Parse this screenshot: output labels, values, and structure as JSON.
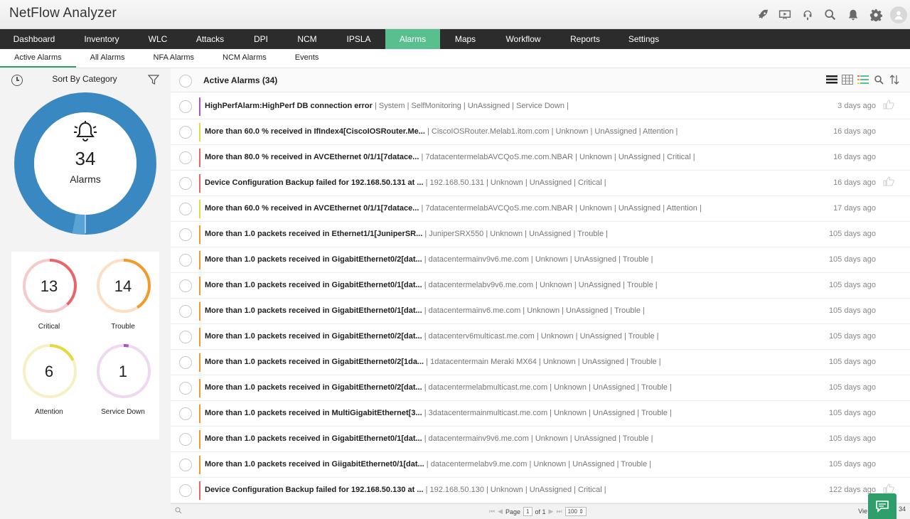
{
  "app": {
    "title": "NetFlow Analyzer"
  },
  "top_icons": [
    "rocket-icon",
    "presentation-icon",
    "headset-icon",
    "search-icon",
    "bell-icon",
    "gear-icon",
    "user-icon"
  ],
  "nav": {
    "items": [
      {
        "label": "Dashboard",
        "active": false
      },
      {
        "label": "Inventory",
        "active": false
      },
      {
        "label": "WLC",
        "active": false
      },
      {
        "label": "Attacks",
        "active": false
      },
      {
        "label": "DPI",
        "active": false
      },
      {
        "label": "NCM",
        "active": false
      },
      {
        "label": "IPSLA",
        "active": false
      },
      {
        "label": "Alarms",
        "active": true
      },
      {
        "label": "Maps",
        "active": false
      },
      {
        "label": "Workflow",
        "active": false
      },
      {
        "label": "Reports",
        "active": false
      },
      {
        "label": "Settings",
        "active": false
      }
    ]
  },
  "subnav": {
    "items": [
      {
        "label": "Active Alarms",
        "active": true
      },
      {
        "label": "All Alarms",
        "active": false
      },
      {
        "label": "NFA Alarms",
        "active": false
      },
      {
        "label": "NCM Alarms",
        "active": false
      },
      {
        "label": "Events",
        "active": false
      }
    ]
  },
  "sidebar": {
    "sort_label": "Sort By Category",
    "donut": {
      "count": "34",
      "label": "Alarms",
      "segments": [
        {
          "name": "Critical",
          "value": 13,
          "color": "#3a88c2"
        },
        {
          "name": "Trouble",
          "value": 14,
          "color": "#3a88c2"
        },
        {
          "name": "Attention",
          "value": 6,
          "color": "#3a88c2"
        },
        {
          "name": "Service Down",
          "value": 1,
          "color": "#5aa3d6"
        }
      ]
    },
    "severities": [
      {
        "name": "Critical",
        "count": "13",
        "color": "#e8666a",
        "track": "#f6c9ca",
        "fraction": 0.38
      },
      {
        "name": "Trouble",
        "count": "14",
        "color": "#f39a2b",
        "track": "#fde0c3",
        "fraction": 0.41
      },
      {
        "name": "Attention",
        "count": "6",
        "color": "#e6d840",
        "track": "#f6f1c4",
        "fraction": 0.18
      },
      {
        "name": "Service Down",
        "count": "1",
        "color": "#a855c7",
        "track": "#efd8f2",
        "fraction": 0.03
      }
    ]
  },
  "list": {
    "title": "Active Alarms (34)",
    "rows": [
      {
        "msg": "HighPerfAlarm:HighPerf DB connection error",
        "details": " | System | SelfMonitoring | UnAssigned | Service Down |",
        "age": "3 days ago",
        "color": "#a855c7",
        "thumb": true
      },
      {
        "msg": "More than 60.0 % received in IfIndex4[CiscoIOSRouter.Me...",
        "details": " | CiscoIOSRouter.Melab1.itom.com | Unknown | UnAssigned | Attention |",
        "age": "16 days ago",
        "color": "#e6d840",
        "thumb": false
      },
      {
        "msg": "More than 80.0 % received in AVCEthernet 0/1/1[7datace...",
        "details": " | 7datacentermelabAVCQoS.me.com.NBAR | Unknown | UnAssigned | Critical |",
        "age": "16 days ago",
        "color": "#e8666a",
        "thumb": false
      },
      {
        "msg": "Device Configuration Backup failed for 192.168.50.131 at ...",
        "details": " | 192.168.50.131 | Unknown | UnAssigned | Critical |",
        "age": "16 days ago",
        "color": "#e8666a",
        "thumb": true
      },
      {
        "msg": "More than 60.0 % received in AVCEthernet 0/1/1[7datace...",
        "details": " | 7datacentermelabAVCQoS.me.com.NBAR | Unknown | UnAssigned | Attention |",
        "age": "17 days ago",
        "color": "#e6d840",
        "thumb": false
      },
      {
        "msg": "More than 1.0 packets received in Ethernet1/1[JuniperSR...",
        "details": " | JuniperSRX550 | Unknown | UnAssigned | Trouble |",
        "age": "105 days ago",
        "color": "#f39a2b",
        "thumb": false
      },
      {
        "msg": "More than 1.0 packets received in GigabitEthernet0/2[dat...",
        "details": " | datacentermainv9v6.me.com | Unknown | UnAssigned | Trouble |",
        "age": "105 days ago",
        "color": "#f39a2b",
        "thumb": false
      },
      {
        "msg": "More than 1.0 packets received in GigabitEthernet0/1[dat...",
        "details": " | datacentermelabv9v6.me.com | Unknown | UnAssigned | Trouble |",
        "age": "105 days ago",
        "color": "#f39a2b",
        "thumb": false
      },
      {
        "msg": "More than 1.0 packets received in GigabitEthernet0/1[dat...",
        "details": " | datacentermainv6.me.com | Unknown | UnAssigned | Trouble |",
        "age": "105 days ago",
        "color": "#f39a2b",
        "thumb": false
      },
      {
        "msg": "More than 1.0 packets received in GigabitEthernet0/2[dat...",
        "details": " | datacenterv6multicast.me.com | Unknown | UnAssigned | Trouble |",
        "age": "105 days ago",
        "color": "#f39a2b",
        "thumb": false
      },
      {
        "msg": "More than 1.0 packets received in GigabitEthernet0/2[1da...",
        "details": " | 1datacentermain Meraki MX64 | Unknown | UnAssigned | Trouble |",
        "age": "105 days ago",
        "color": "#f39a2b",
        "thumb": false
      },
      {
        "msg": "More than 1.0 packets received in GigabitEthernet0/2[dat...",
        "details": " | datacentermelabmulticast.me.com | Unknown | UnAssigned | Trouble |",
        "age": "105 days ago",
        "color": "#f39a2b",
        "thumb": false
      },
      {
        "msg": "More than 1.0 packets received in MultiGigabitEthernet[3...",
        "details": " | 3datacentermainmulticast.me.com | Unknown | UnAssigned | Trouble |",
        "age": "105 days ago",
        "color": "#f39a2b",
        "thumb": false
      },
      {
        "msg": "More than 1.0 packets received in GigabitEthernet0/1[dat...",
        "details": " | datacentermainv9v6.me.com | Unknown | UnAssigned | Trouble |",
        "age": "105 days ago",
        "color": "#f39a2b",
        "thumb": false
      },
      {
        "msg": "More than 1.0 packets received in GiigabitEthernet0/1[dat...",
        "details": " | datacentermelabv9.me.com | Unknown | UnAssigned | Trouble |",
        "age": "105 days ago",
        "color": "#f39a2b",
        "thumb": false
      },
      {
        "msg": "Device Configuration Backup failed for 192.168.50.130 at ...",
        "details": " | 192.168.50.130 | Unknown | UnAssigned | Critical |",
        "age": "122 days ago",
        "color": "#e8666a",
        "thumb": true
      }
    ]
  },
  "footer": {
    "page_label": "Page",
    "page_value": "1",
    "of_label": "of 1",
    "per_page": "100",
    "view_label": "Vie",
    "count_tail": "34"
  }
}
